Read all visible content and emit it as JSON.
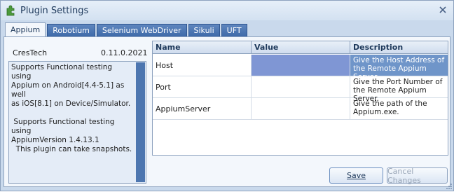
{
  "window": {
    "title": "Plugin Settings",
    "icon": "plugin-puzzle-icon",
    "close_icon": "close-icon"
  },
  "tabs": [
    {
      "label": "Appium",
      "active": true
    },
    {
      "label": "Robotium",
      "active": false
    },
    {
      "label": "Selenium WebDriver",
      "active": false
    },
    {
      "label": "Sikuli",
      "active": false
    },
    {
      "label": "UFT",
      "active": false
    }
  ],
  "plugin": {
    "vendor": "CresTech",
    "version": "0.11.0.2021",
    "description": "Supports Functional testing using\nAppium on Android[4.4-5.1] as well\nas iOS[8.1] on Device/Simulator.\n\n Supports Functional testing using\nAppiumVersion 1.4.13.1\n  This plugin can take snapshots."
  },
  "grid": {
    "columns": [
      "Name",
      "Value",
      "Description"
    ],
    "rows": [
      {
        "name": "Host",
        "value": "",
        "description": "Give the Host Address of the Remote Appium Server.",
        "selected": true
      },
      {
        "name": "Port",
        "value": "",
        "description": "Give the Port Number of the Remote Appium Server.",
        "selected": false
      },
      {
        "name": "AppiumServer",
        "value": "",
        "description": "Give the path of the Appium.exe.",
        "selected": false
      }
    ]
  },
  "buttons": {
    "save": "Save",
    "cancel": "Cancel Changes"
  },
  "colors": {
    "accent": "#3e6aa9",
    "selection": "#6f95c9",
    "frame": "#c9d9ec"
  }
}
